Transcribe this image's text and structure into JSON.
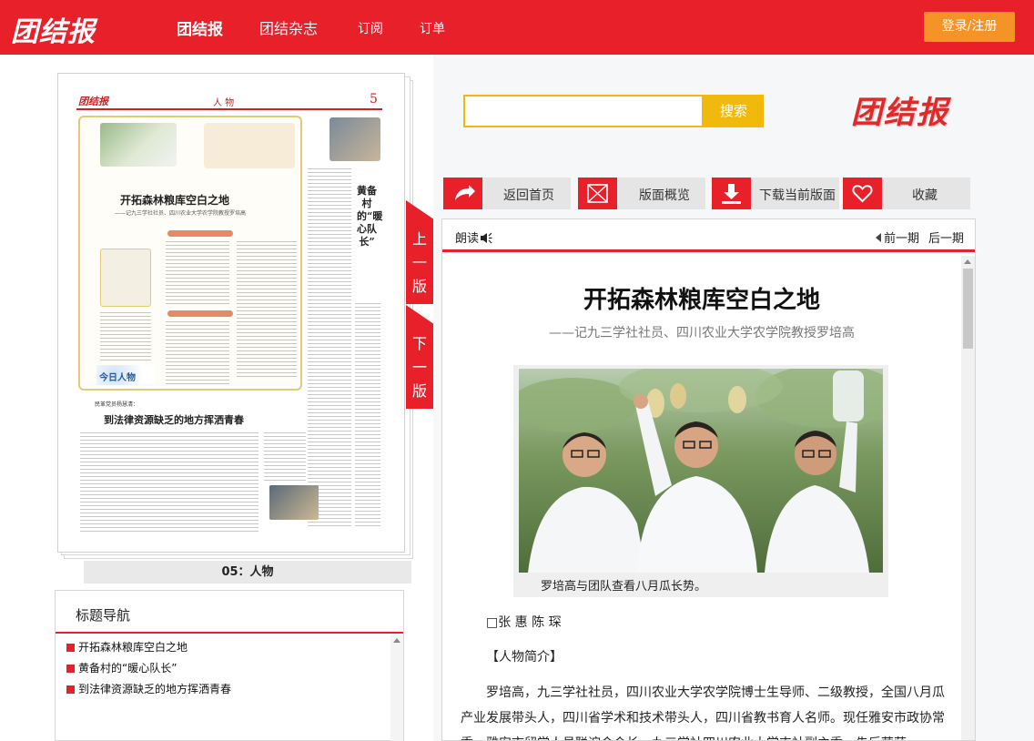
{
  "header": {
    "logo_text": "团结报",
    "nav": [
      {
        "label": "团结报",
        "active": true
      },
      {
        "label": "团结杂志",
        "active": false
      },
      {
        "label": "订阅",
        "active": false
      },
      {
        "label": "订单",
        "active": false
      }
    ],
    "login_label": "登录/注册"
  },
  "newspaper_page": {
    "header_logo": "团结报",
    "section_name": "人 物",
    "page_number": "5",
    "main_title": "开拓森林粮库空白之地",
    "main_subtitle": "——记九三学社社员、四川农业大学农学院教授罗培高",
    "vertical_title": "黄备村的“暖心队长”",
    "column_badge": "今日人物",
    "second_kicker": "民革党员杨慧清：",
    "second_title": "到法律资源缺乏的地方挥洒青春",
    "caption": "05：人物"
  },
  "pager": {
    "prev_label": "上一版",
    "next_label": "下一版"
  },
  "toc": {
    "title": "标题导航",
    "items": [
      "开拓森林粮库空白之地",
      "黄备村的“暖心队长”",
      "到法律资源缺乏的地方挥洒青春"
    ]
  },
  "search": {
    "value": "",
    "placeholder": "",
    "button_label": "搜索"
  },
  "logo2_text": "团结报",
  "tools": [
    {
      "label": "返回首页",
      "icon": "back-arrow-icon"
    },
    {
      "label": "版面概览",
      "icon": "envelope-icon"
    },
    {
      "label": "下载当前版面",
      "icon": "download-icon"
    },
    {
      "label": "收藏",
      "icon": "heart-icon"
    }
  ],
  "article": {
    "read_label": "朗读",
    "prev_issue": "前一期",
    "next_issue": "后一期",
    "title": "开拓森林粮库空白之地",
    "subtitle": "——记九三学社社员、四川农业大学农学院教授罗培高",
    "photo_caption": "罗培高与团队查看八月瓜长势。",
    "byline": "□张 惠 陈 琛",
    "intro_heading": "【人物简介】",
    "body": "罗培高，九三学社社员，四川农业大学农学院博士生导师、二级教授，全国八月瓜产业发展带头人，四川省学术和技术带头人，四川省教书育人名师。现任雅安市政协常委、雅安市留学人员联谊会会长、九三学社四川农业大学支社副主委。先后荣获"
  },
  "colors": {
    "brand_red": "#e8202a",
    "login_orange": "#f59326",
    "search_yellow": "#f2b90d"
  }
}
